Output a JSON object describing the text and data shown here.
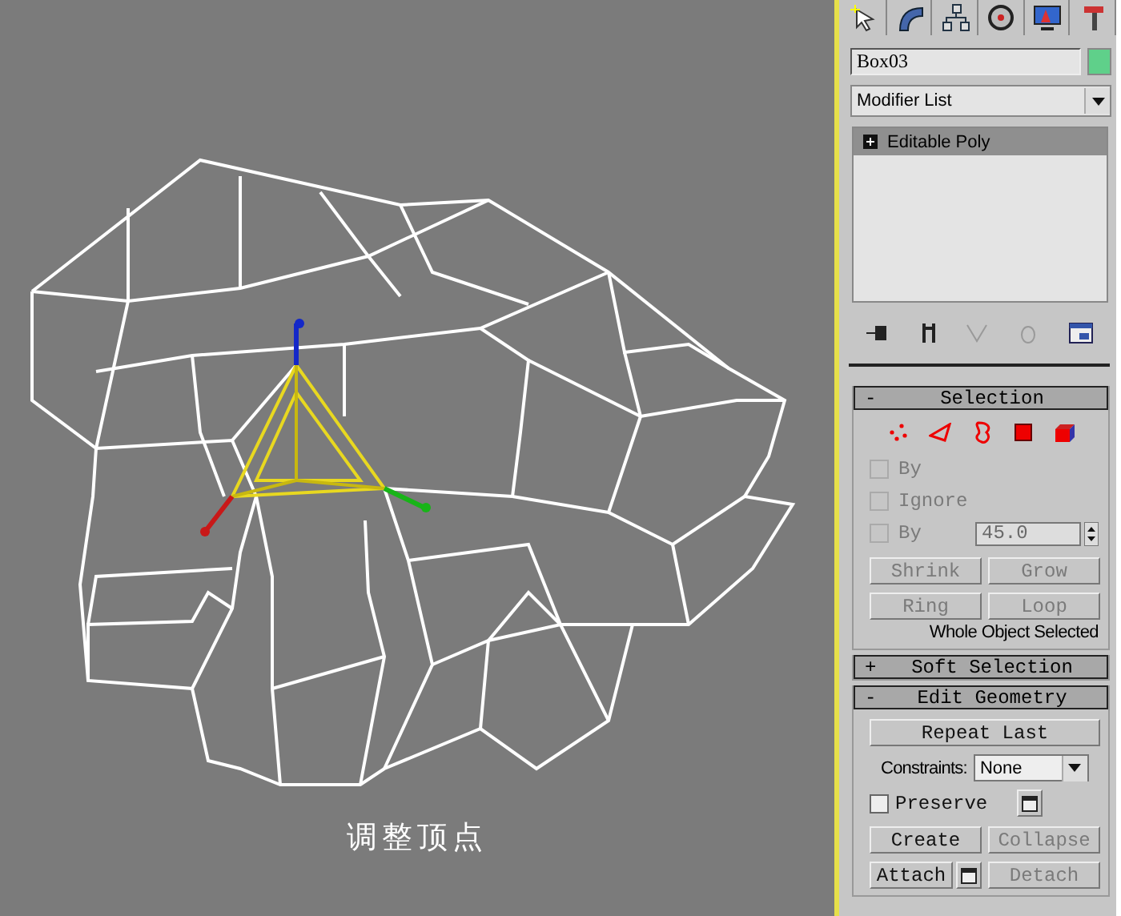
{
  "viewport": {
    "caption": "调整顶点"
  },
  "command_tabs": [
    {
      "kind": "create"
    },
    {
      "kind": "modify"
    },
    {
      "kind": "hierarchy"
    },
    {
      "kind": "motion"
    },
    {
      "kind": "display"
    },
    {
      "kind": "utilities"
    }
  ],
  "object_name": "Box03",
  "modifier_list": {
    "value": "Modifier List"
  },
  "modifier_stack": [
    {
      "label": "Editable Poly",
      "selected": true
    }
  ],
  "stack_tools": [
    {
      "kind": "pin",
      "disabled": false
    },
    {
      "kind": "result",
      "disabled": false
    },
    {
      "kind": "unique",
      "disabled": true
    },
    {
      "kind": "remove",
      "disabled": true
    },
    {
      "kind": "configure",
      "disabled": false
    }
  ],
  "selection": {
    "toggle": "-",
    "title": "Selection",
    "expanded": true,
    "subobjects": [
      {
        "kind": "vertex",
        "selected": false
      },
      {
        "kind": "edge",
        "selected": false
      },
      {
        "kind": "border",
        "selected": false
      },
      {
        "kind": "polygon",
        "selected": false
      },
      {
        "kind": "element",
        "selected": false
      }
    ],
    "options": [
      {
        "label": "By",
        "checked": false,
        "disabled": true
      },
      {
        "label": "Ignore",
        "checked": false,
        "disabled": true
      },
      {
        "label": "By",
        "checked": false,
        "disabled": true
      }
    ],
    "angle": {
      "value": "45.0",
      "disabled": true
    },
    "buttons": [
      {
        "label": "Shrink",
        "disabled": true
      },
      {
        "label": "Grow",
        "disabled": true
      },
      {
        "label": "Ring",
        "disabled": true
      },
      {
        "label": "Loop",
        "disabled": true
      }
    ],
    "status": "Whole Object Selected"
  },
  "soft_selection": {
    "toggle": "+",
    "title": "Soft Selection",
    "expanded": false
  },
  "edit_geometry": {
    "toggle": "-",
    "title": "Edit Geometry",
    "expanded": true,
    "repeat": {
      "label": "Repeat Last",
      "disabled": false
    },
    "constraints": {
      "label": "Constraints:",
      "value": "None"
    },
    "preserve": {
      "label": "Preserve",
      "checked": false,
      "disabled": false
    },
    "buttons": [
      {
        "label": "Create",
        "disabled": false,
        "settings": false
      },
      {
        "label": "Collapse",
        "disabled": true,
        "settings": false
      },
      {
        "label": "Attach",
        "disabled": false,
        "settings": true
      },
      {
        "label": "Detach",
        "disabled": true,
        "settings": false
      }
    ]
  }
}
